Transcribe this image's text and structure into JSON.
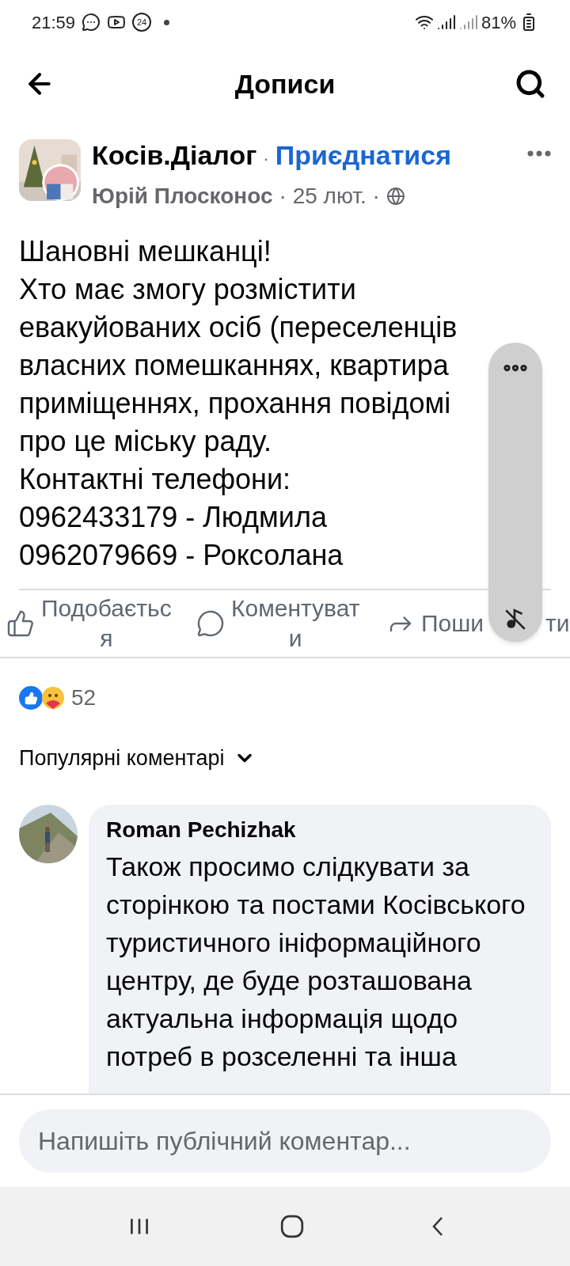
{
  "status_bar": {
    "time": "21:59",
    "notification_badge": "24",
    "battery": "81%"
  },
  "header": {
    "title": "Дописи"
  },
  "post": {
    "group": "Косів.Діалог",
    "separator": "·",
    "join": "Приєднатися",
    "author": "Юрій Плосконос",
    "date": "· 25 лют. ·",
    "lines": [
      "Шановні мешканці!",
      "Хто має змогу розмістити",
      "евакуйованих осіб (переселенців",
      "власних помешканнях, квартира",
      "приміщеннях, прохання повідомі",
      "про це міську раду.",
      "Контактні телефони:",
      "0962433179 - Людмила",
      "0962079669 - Роксолана"
    ],
    "actions": [
      {
        "kind": "like",
        "lines": [
          "Подобаєтьс",
          "я"
        ]
      },
      {
        "kind": "comment",
        "lines": [
          "Коментуват",
          "и"
        ]
      },
      {
        "kind": "share",
        "lines": [
          "Поши"
        ],
        "after": "ти"
      }
    ],
    "reaction_count": "52"
  },
  "comments_sort": "Популярні коментарі",
  "comments": [
    {
      "author": "Roman Pechizhak",
      "text": "Також просимо слідкувати за сторінкою та постами Косівського туристичного ініформаційного центру, де буде розташована актуальна інформація щодо потреб в розселенні та інша"
    }
  ],
  "composer": {
    "placeholder": "Напишіть публічний коментар..."
  }
}
